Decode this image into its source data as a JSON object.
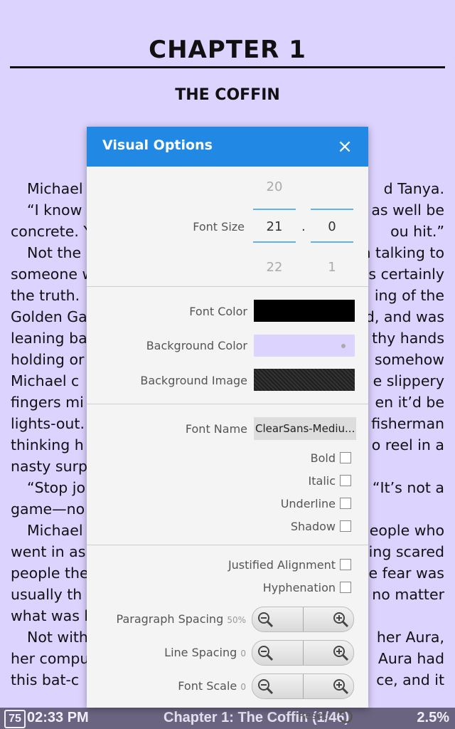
{
  "reader": {
    "chapter_title": "CHAPTER 1",
    "chapter_subtitle": "THE COFFIN",
    "lines": [
      {
        "left": "Michael",
        "right": "d Tanya.",
        "indent": true
      },
      {
        "left": "“I know",
        "right": "as well be",
        "indent": true
      },
      {
        "left": "concrete. Y",
        "right": "ou hit.”",
        "indent": false
      },
      {
        "left": "Not the r",
        "right": "n talking to",
        "indent": true
      },
      {
        "left": "someone w",
        "right": "s certainly",
        "indent": false
      },
      {
        "left": "the truth.",
        "right": "ing of the",
        "indent": false
      },
      {
        "left": "Golden Ga",
        "right": "d, and was",
        "indent": false
      },
      {
        "left": "leaning  ba",
        "right": "thy  hands",
        "indent": false
      },
      {
        "left": "holding  or",
        "right": "somehow",
        "indent": false
      },
      {
        "left": "Michael  c",
        "right": "e  slippery",
        "indent": false
      },
      {
        "left": "fingers mi",
        "right": "en it’d be",
        "indent": false
      },
      {
        "left": "lights-out.",
        "right": "fisherman",
        "indent": false
      },
      {
        "left": "thinking h",
        "right": "o reel in a",
        "indent": false
      },
      {
        "left": "nasty surp",
        "right": "",
        "indent": false
      },
      {
        "left": "“Stop jo",
        "right": "“It’s not a",
        "indent": true
      },
      {
        "left": "game—no",
        "right": "",
        "indent": false
      },
      {
        "left": "Michael",
        "right": "eople who",
        "indent": true
      },
      {
        "left": "went in as",
        "right": "ing scared",
        "indent": false
      },
      {
        "left": "people the",
        "right": "e fear was",
        "indent": false
      },
      {
        "left": "usually  th",
        "right": "no matter",
        "indent": false
      },
      {
        "left": "what was h",
        "right": "",
        "indent": false
      },
      {
        "left": "Not with",
        "right": "her Aura,",
        "indent": true
      },
      {
        "left": "her compu",
        "right": "Aura had",
        "indent": false
      },
      {
        "left": "this  bat-c",
        "right": "ce,  and  it",
        "indent": false
      }
    ]
  },
  "status": {
    "battery": "75",
    "time": "02:33 PM",
    "chapter": "Chapter 1: The Coffin (1/46)",
    "progress": "2.5%"
  },
  "dialog": {
    "title": "Visual Options",
    "close_label": "×",
    "font_size": {
      "label": "Font Size",
      "int_prev": "20",
      "int_value": "21",
      "int_next": "22",
      "separator": ".",
      "frac_prev": "",
      "frac_value": "0",
      "frac_next": "1"
    },
    "font_color_label": "Font Color",
    "background_color_label": "Background Color",
    "background_image_label": "Background Image",
    "font_name_label": "Font Name",
    "font_name_value": "ClearSans-Mediu...",
    "bold_label": "Bold",
    "italic_label": "Italic",
    "underline_label": "Underline",
    "shadow_label": "Shadow",
    "justified_label": "Justified Alignment",
    "hyphenation_label": "Hyphenation",
    "paragraph_spacing_label": "Paragraph Spacing",
    "paragraph_spacing_value": "50%",
    "line_spacing_label": "Line Spacing",
    "line_spacing_value": "0",
    "font_scale_label": "Font Scale",
    "font_scale_value": "0",
    "reset_label": "Reset:"
  },
  "colors": {
    "page_background": "#ddd3ff",
    "font_color": "#000000",
    "accent": "#2189e3",
    "status_bar": "#6b6480"
  },
  "icons": [
    "close-icon",
    "zoom-out-icon",
    "zoom-in-icon",
    "reset-icon",
    "battery-icon"
  ]
}
